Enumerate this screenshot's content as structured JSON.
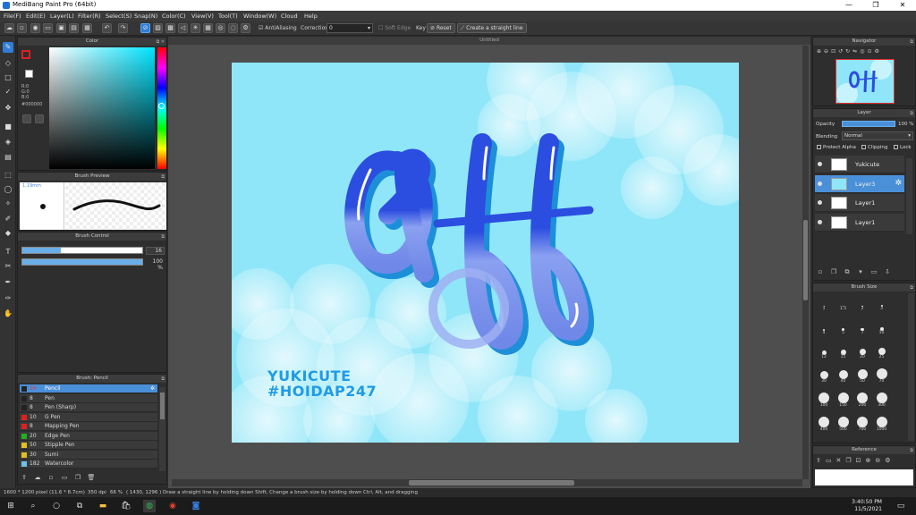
{
  "app": {
    "title": "MediBang Paint Pro (64bit)",
    "window_controls": [
      "—",
      "❐",
      "✕"
    ]
  },
  "menu": [
    "File(F)",
    "Edit(E)",
    "Layer(L)",
    "Filter(R)",
    "Select(S)",
    "Snap(N)",
    "Color(C)",
    "View(V)",
    "Tool(T)",
    "Window(W)",
    "Cloud",
    "Help"
  ],
  "toolbar": {
    "antialiasing_label": "AntiAliasing",
    "correction_label": "Correction",
    "correction_value": "0",
    "soft_edge_label": "Soft Edge",
    "key_label": "Key",
    "reset_label": "Reset",
    "straight_line_label": "Create a straight line"
  },
  "color_panel": {
    "title": "Color",
    "r": "R:0",
    "g": "G:0",
    "b": "B:0",
    "hex": "#000000",
    "primary_color": "#000000",
    "secondary_color": "#ffffff"
  },
  "brush_preview": {
    "title": "Brush Preview",
    "size_label": "1.19mm"
  },
  "brush_control": {
    "title": "Brush Control",
    "size_value": "16",
    "opacity_value": "100 %",
    "size_fraction": 0.32,
    "opacity_fraction": 1.0
  },
  "brush_list": {
    "title": "Brush: Pencil",
    "items": [
      {
        "size": "16",
        "name": "Pencil",
        "color": "#222222",
        "selected": true
      },
      {
        "size": "8",
        "name": "Pen",
        "color": "#222222"
      },
      {
        "size": "8",
        "name": "Pen (Sharp)",
        "color": "#222222"
      },
      {
        "size": "10",
        "name": "G Pen",
        "color": "#e02020"
      },
      {
        "size": "8",
        "name": "Mapping Pen",
        "color": "#e02020"
      },
      {
        "size": "20",
        "name": "Edge Pen",
        "color": "#20b020"
      },
      {
        "size": "50",
        "name": "Stipple Pen",
        "color": "#e0c020"
      },
      {
        "size": "30",
        "name": "Sumi",
        "color": "#e0c020"
      },
      {
        "size": "182",
        "name": "Watercolor",
        "color": "#70c0e8"
      }
    ]
  },
  "document": {
    "tab_title": "Untitled",
    "canvas_text_line1": "YUKICUTE",
    "canvas_text_line2": "#HOIDAP247",
    "canvas_bg": "#8fe6f8"
  },
  "navigator": {
    "title": "Navigator"
  },
  "layer_panel": {
    "title": "Layer",
    "opacity_label": "Opacity",
    "opacity_value": "100 %",
    "blending_label": "Blending",
    "blending_value": "Normal",
    "protect_alpha": "Protect Alpha",
    "clipping": "Clipping",
    "lock": "Lock",
    "layers": [
      {
        "name": "Yukicute",
        "selected": false
      },
      {
        "name": "Layer3",
        "selected": true
      },
      {
        "name": "Layer1",
        "selected": false
      },
      {
        "name": "Layer1",
        "selected": false
      }
    ]
  },
  "brush_size_panel": {
    "title": "Brush Size",
    "sizes": [
      "1",
      "1.5",
      "2",
      "3",
      "4",
      "5",
      "7",
      "10",
      "12",
      "15",
      "20",
      "25",
      "30",
      "40",
      "50",
      "70",
      "100",
      "150",
      "200",
      "300",
      "400",
      "500",
      "700",
      "1000"
    ]
  },
  "reference_panel": {
    "title": "Reference"
  },
  "status": {
    "pixels": "1600 * 1200 pixel",
    "cm": "(11.6 * 8.7cm)",
    "dpi": "350 dpi",
    "zoom": "66 %",
    "cursor": "( 1430, 1296 )",
    "hint": "Draw a straight line by holding down Shift, Change a brush size by holding down Ctrl, Alt, and dragging"
  },
  "taskbar": {
    "time": "3:40:50 PM",
    "date": "11/5/2021"
  },
  "colors": {
    "accent": "#2f7fd8",
    "letter_blue": "#2b4de0",
    "letter_light": "#8aa0f0"
  }
}
